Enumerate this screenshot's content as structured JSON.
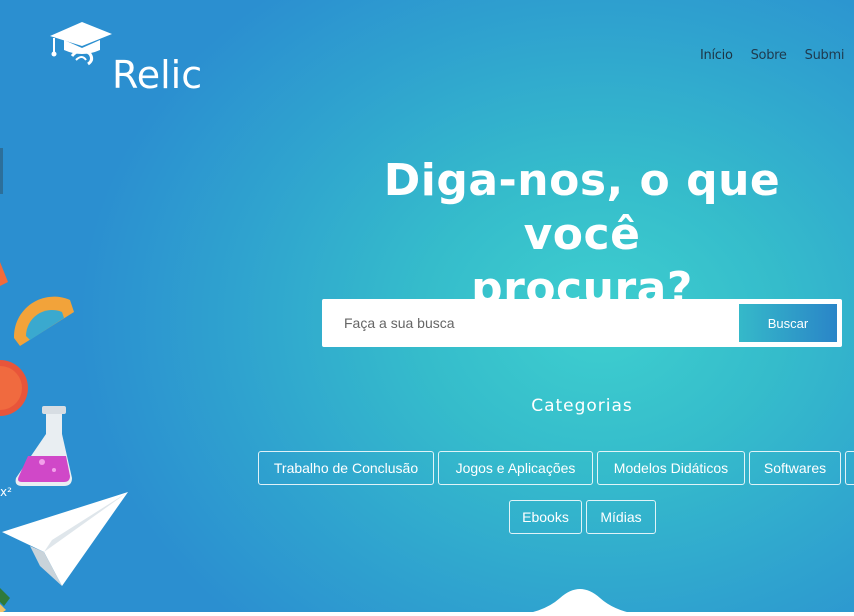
{
  "brand": {
    "name": "Relic"
  },
  "nav": {
    "items": [
      {
        "label": "Início"
      },
      {
        "label": "Sobre"
      },
      {
        "label": "Submi"
      }
    ]
  },
  "hero": {
    "line1": "Diga-nos, o que você",
    "line2": "procura?"
  },
  "search": {
    "placeholder": "Faça a sua busca",
    "value": "",
    "button_label": "Buscar"
  },
  "categories": {
    "title": "Categorias",
    "items": [
      {
        "label": "Trabalho de Conclusão"
      },
      {
        "label": "Jogos e Aplicações"
      },
      {
        "label": "Modelos Didáticos"
      },
      {
        "label": "Softwares"
      },
      {
        "label": ""
      },
      {
        "label": "Ebooks"
      },
      {
        "label": "Mídias"
      }
    ]
  },
  "decorations": {
    "math_text": "x²",
    "icons": [
      "graduation-cap-icon",
      "protractor-icon",
      "flask-icon",
      "paper-plane-icon",
      "pencil-icon"
    ]
  },
  "colors": {
    "background_center": "#3ecfcf",
    "background_edge": "#2b8fd0",
    "button_gradient_start": "#35b9c9",
    "button_gradient_end": "#2a85c8"
  }
}
